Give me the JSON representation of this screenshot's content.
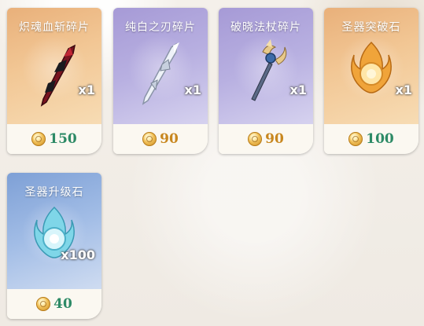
{
  "items": [
    {
      "name": "炽魂血斩碎片",
      "qty": "x1",
      "price": "150",
      "price_color": "#2d8a66",
      "rarity": "orange",
      "icon": "crimson-sword-fragment-icon"
    },
    {
      "name": "纯白之刃碎片",
      "qty": "x1",
      "price": "90",
      "price_color": "#c8871f",
      "rarity": "purple",
      "icon": "white-blade-fragment-icon"
    },
    {
      "name": "破晓法杖碎片",
      "qty": "x1",
      "price": "90",
      "price_color": "#c8871f",
      "rarity": "purple",
      "icon": "dawn-staff-fragment-icon"
    },
    {
      "name": "圣器突破石",
      "qty": "x1",
      "price": "100",
      "price_color": "#2d8a66",
      "rarity": "orange",
      "icon": "relic-breakthrough-stone-icon"
    },
    {
      "name": "圣器升级石",
      "qty": "x100",
      "price": "40",
      "price_color": "#2d8a66",
      "rarity": "blue",
      "icon": "relic-upgrade-stone-icon"
    }
  ]
}
